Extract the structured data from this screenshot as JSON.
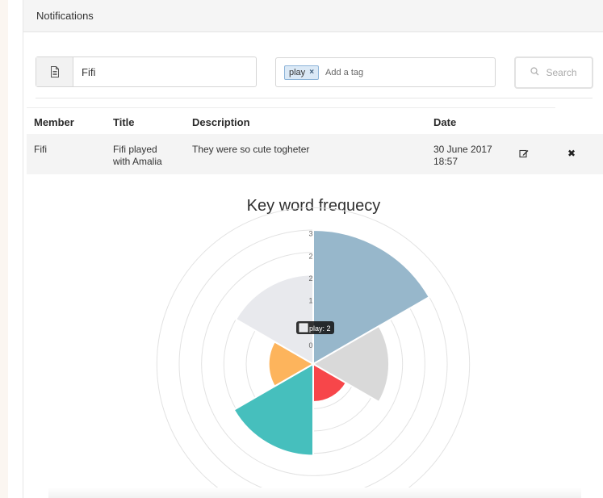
{
  "panel": {
    "title": "Notifications"
  },
  "filters": {
    "member_value": "Fifi",
    "tags": [
      {
        "label": "play",
        "remove": "×"
      }
    ],
    "tag_placeholder": "Add a tag",
    "search_label": "Search"
  },
  "table": {
    "headers": [
      "Member",
      "Title",
      "Description",
      "Date"
    ],
    "rows": [
      {
        "member": "Fifi",
        "title_line1": "Fifi played",
        "title_line2": "with Amalia",
        "description": "They were so cute togheter",
        "date_line1": "30 June 2017",
        "date_line2": "18:57",
        "delete_glyph": "✖"
      }
    ]
  },
  "chart": {
    "title": "Key word frequecy"
  },
  "chart_data": {
    "type": "polarArea",
    "title": "Key word frequecy",
    "r_axis": {
      "min": 0,
      "max": 3,
      "tick_labels": [
        "0",
        "1",
        "1",
        "2",
        "2",
        "3"
      ],
      "visible_tick_labels": [
        "0",
        "1",
        "2",
        "2",
        "3"
      ]
    },
    "tooltip": {
      "label": "play: 2"
    },
    "segments": [
      {
        "value": 3.0,
        "color": "#97b7cb"
      },
      {
        "value": 1.7,
        "color": "#d9d9d9"
      },
      {
        "value": 0.85,
        "color": "#f7464a"
      },
      {
        "value": 2.05,
        "color": "#46bfbd"
      },
      {
        "value": 1.0,
        "color": "#fdb45c"
      },
      {
        "value": 2.0,
        "color": "#e8e9ed"
      }
    ],
    "grid": true,
    "legend": "none"
  }
}
